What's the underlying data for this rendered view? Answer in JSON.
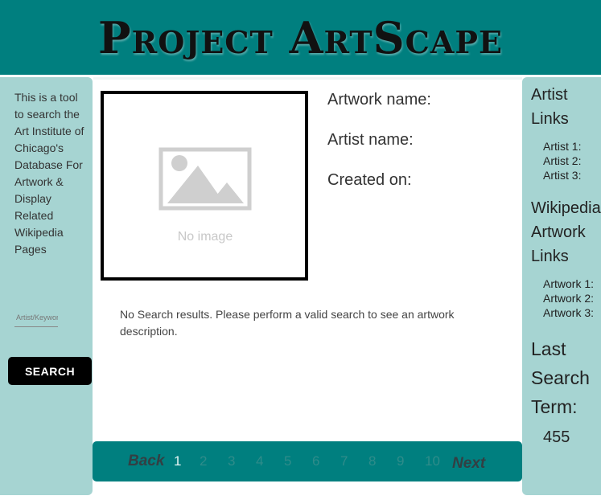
{
  "header": {
    "title": "Project ArtScape"
  },
  "left_sidebar": {
    "description": "This is a tool to search the Art Institute of Chicago's Database For Artwork & Display Related Wikipedia Pages",
    "search_placeholder": "Artist/Keyword",
    "search_value": "",
    "search_button_label": "SEARCH"
  },
  "artwork": {
    "image_caption": "No image",
    "artwork_name_label": "Artwork name:",
    "artist_name_label": "Artist name:",
    "created_on_label": "Created on:",
    "no_results_text": "No Search results. Please perform a valid search to see an artwork description."
  },
  "pagination": {
    "back_label": "Back",
    "next_label": "Next",
    "pages": [
      "1",
      "2",
      "3",
      "4",
      "5",
      "6",
      "7",
      "8",
      "9",
      "10"
    ],
    "active_page": "1"
  },
  "right_sidebar": {
    "artist_links_title": "Artist Links",
    "artist_links": [
      "Artist 1:",
      "Artist 2:",
      "Artist 3:"
    ],
    "wiki_links_title": "Wikipedia Artwork Links",
    "wiki_links": [
      "Artwork 1:",
      "Artwork 2:",
      "Artwork 3:"
    ],
    "last_search_title": "Last Search Term:",
    "last_search_term": "455"
  },
  "colors": {
    "header_bg": "#007f7f",
    "sidebar_bg": "#a6d4d2",
    "pagination_bg": "#007f7f",
    "button_bg": "#000000"
  }
}
